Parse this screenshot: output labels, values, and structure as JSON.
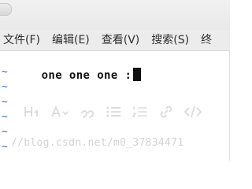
{
  "menu": {
    "items": [
      {
        "label": "文件(F)"
      },
      {
        "label": "编辑(E)"
      },
      {
        "label": "查看(V)"
      },
      {
        "label": "搜索(S)"
      },
      {
        "label": "终"
      }
    ]
  },
  "editor": {
    "line1": "one one one :",
    "empty_line_marker": "~"
  },
  "watermark": {
    "text": "//blog.csdn.net/m0_37834471"
  },
  "ghost_toolbar": {
    "icons": [
      "heading-icon",
      "text-color-icon",
      "quote-icon",
      "unordered-list-icon",
      "ordered-list-icon",
      "link-icon",
      "code-icon"
    ]
  }
}
